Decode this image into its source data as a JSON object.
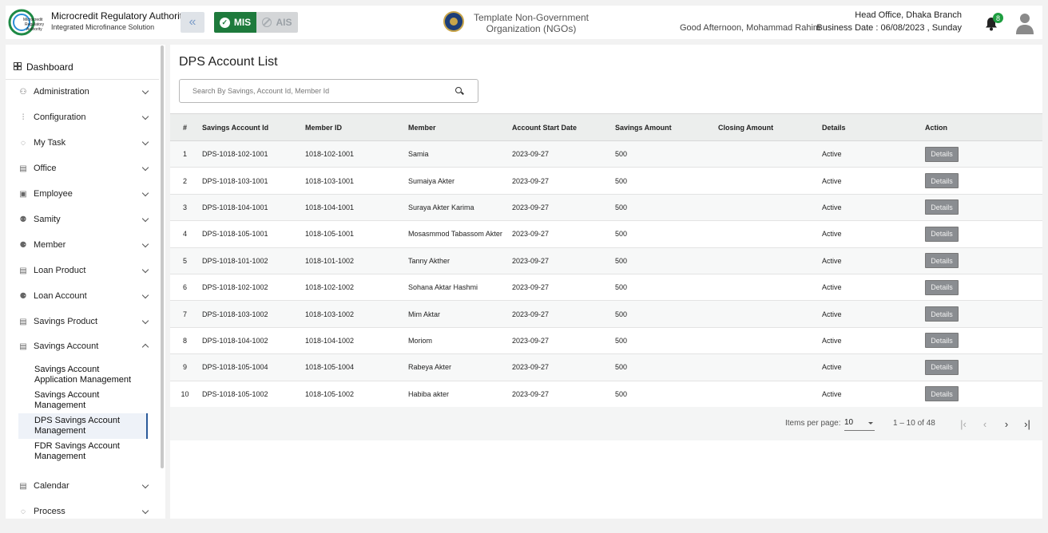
{
  "header": {
    "brand_title": "Microcredit Regulatory Authority",
    "brand_subtitle": "Integrated Microfinance Solution",
    "mis_label": "MIS",
    "ais_label": "AIS",
    "org_line1": "Template Non-Government",
    "org_line2": "Organization (NGOs)",
    "greeting": "Good Afternoon, Mohammad Rahim",
    "branch": "Head Office, Dhaka Branch",
    "business_date": "Business Date : 06/08/2023 , Sunday",
    "notification_count": "8",
    "colors": {
      "mis": "#1e7a3c",
      "badge": "#1e9e40"
    }
  },
  "sidebar": {
    "dashboard": "Dashboard",
    "items": [
      {
        "label": "Administration",
        "icon": "users-cog-icon",
        "expanded": false
      },
      {
        "label": "Configuration",
        "icon": "sliders-icon",
        "expanded": false
      },
      {
        "label": "My Task",
        "icon": "task-icon",
        "expanded": false
      },
      {
        "label": "Office",
        "icon": "building-icon",
        "expanded": false
      },
      {
        "label": "Employee",
        "icon": "employee-icon",
        "expanded": false
      },
      {
        "label": "Samity",
        "icon": "group-icon",
        "expanded": false
      },
      {
        "label": "Member",
        "icon": "members-icon",
        "expanded": false
      },
      {
        "label": "Loan Product",
        "icon": "building-icon",
        "expanded": false
      },
      {
        "label": "Loan Account",
        "icon": "members-icon",
        "expanded": false
      },
      {
        "label": "Savings Product",
        "icon": "building-icon",
        "expanded": false
      },
      {
        "label": "Savings Account",
        "icon": "building-icon",
        "expanded": true
      }
    ],
    "sub_items": [
      {
        "line1": "Savings Account",
        "line2": "Application Management",
        "active": false
      },
      {
        "line1": "Savings Account",
        "line2": "Management",
        "active": false
      },
      {
        "line1": "DPS Savings Account",
        "line2": "Management",
        "active": true
      },
      {
        "line1": "FDR Savings Account",
        "line2": "Management",
        "active": false
      }
    ],
    "after_items": [
      {
        "label": "Calendar",
        "icon": "building-icon"
      },
      {
        "label": "Process",
        "icon": "process-icon"
      }
    ]
  },
  "main": {
    "title": "DPS Account List",
    "search_placeholder": "Search By Savings, Account Id, Member Id",
    "table": {
      "headers": [
        "#",
        "Savings Account Id",
        "Member ID",
        "Member",
        "Account Start Date",
        "Savings Amount",
        "Closing Amount",
        "Details",
        "Action"
      ],
      "rows": [
        [
          "1",
          "DPS-1018-102-1001",
          "1018-102-1001",
          "Samia",
          "2023-09-27",
          "500",
          "",
          "Active",
          "Details"
        ],
        [
          "2",
          "DPS-1018-103-1001",
          "1018-103-1001",
          "Sumaiya Akter",
          "2023-09-27",
          "500",
          "",
          "Active",
          "Details"
        ],
        [
          "3",
          "DPS-1018-104-1001",
          "1018-104-1001",
          "Suraya Akter Karima",
          "2023-09-27",
          "500",
          "",
          "Active",
          "Details"
        ],
        [
          "4",
          "DPS-1018-105-1001",
          "1018-105-1001",
          "Mosasmmod Tabassom Akter",
          "2023-09-27",
          "500",
          "",
          "Active",
          "Details"
        ],
        [
          "5",
          "DPS-1018-101-1002",
          "1018-101-1002",
          "Tanny Akther",
          "2023-09-27",
          "500",
          "",
          "Active",
          "Details"
        ],
        [
          "6",
          "DPS-1018-102-1002",
          "1018-102-1002",
          "Sohana Aktar Hashmi",
          "2023-09-27",
          "500",
          "",
          "Active",
          "Details"
        ],
        [
          "7",
          "DPS-1018-103-1002",
          "1018-103-1002",
          "Mim Aktar",
          "2023-09-27",
          "500",
          "",
          "Active",
          "Details"
        ],
        [
          "8",
          "DPS-1018-104-1002",
          "1018-104-1002",
          "Moriom",
          "2023-09-27",
          "500",
          "",
          "Active",
          "Details"
        ],
        [
          "9",
          "DPS-1018-105-1004",
          "1018-105-1004",
          "Rabeya Akter",
          "2023-09-27",
          "500",
          "",
          "Active",
          "Details"
        ],
        [
          "10",
          "DPS-1018-105-1002",
          "1018-105-1002",
          "Habiba akter",
          "2023-09-27",
          "500",
          "",
          "Active",
          "Details"
        ]
      ]
    },
    "paginator": {
      "items_per_page_label": "Items per page:",
      "items_per_page": "10",
      "range": "1 – 10 of 48"
    }
  }
}
